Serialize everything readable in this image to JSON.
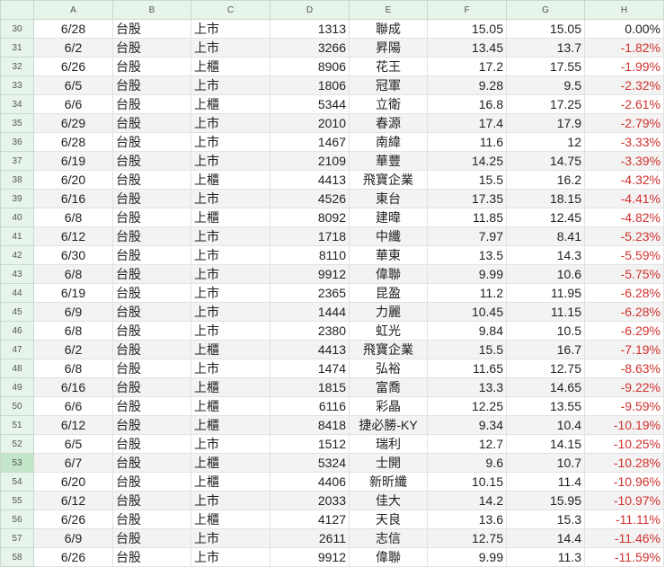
{
  "columns": [
    "A",
    "B",
    "C",
    "D",
    "E",
    "F",
    "G",
    "H"
  ],
  "selected_row": 53,
  "rows": [
    [
      "30",
      "6/28",
      "台股",
      "上市",
      "1313",
      "聯成",
      "15.05",
      "15.05",
      "0.00%"
    ],
    [
      "31",
      "6/2",
      "台股",
      "上市",
      "3266",
      "昇陽",
      "13.45",
      "13.7",
      "-1.82%"
    ],
    [
      "32",
      "6/26",
      "台股",
      "上櫃",
      "8906",
      "花王",
      "17.2",
      "17.55",
      "-1.99%"
    ],
    [
      "33",
      "6/5",
      "台股",
      "上市",
      "1806",
      "冠軍",
      "9.28",
      "9.5",
      "-2.32%"
    ],
    [
      "34",
      "6/6",
      "台股",
      "上櫃",
      "5344",
      "立衛",
      "16.8",
      "17.25",
      "-2.61%"
    ],
    [
      "35",
      "6/29",
      "台股",
      "上市",
      "2010",
      "春源",
      "17.4",
      "17.9",
      "-2.79%"
    ],
    [
      "36",
      "6/28",
      "台股",
      "上市",
      "1467",
      "南緯",
      "11.6",
      "12",
      "-3.33%"
    ],
    [
      "37",
      "6/19",
      "台股",
      "上市",
      "2109",
      "華豐",
      "14.25",
      "14.75",
      "-3.39%"
    ],
    [
      "38",
      "6/20",
      "台股",
      "上櫃",
      "4413",
      "飛寶企業",
      "15.5",
      "16.2",
      "-4.32%"
    ],
    [
      "39",
      "6/16",
      "台股",
      "上市",
      "4526",
      "東台",
      "17.35",
      "18.15",
      "-4.41%"
    ],
    [
      "40",
      "6/8",
      "台股",
      "上櫃",
      "8092",
      "建暐",
      "11.85",
      "12.45",
      "-4.82%"
    ],
    [
      "41",
      "6/12",
      "台股",
      "上市",
      "1718",
      "中纖",
      "7.97",
      "8.41",
      "-5.23%"
    ],
    [
      "42",
      "6/30",
      "台股",
      "上市",
      "8110",
      "華東",
      "13.5",
      "14.3",
      "-5.59%"
    ],
    [
      "43",
      "6/8",
      "台股",
      "上市",
      "9912",
      "偉聯",
      "9.99",
      "10.6",
      "-5.75%"
    ],
    [
      "44",
      "6/19",
      "台股",
      "上市",
      "2365",
      "昆盈",
      "11.2",
      "11.95",
      "-6.28%"
    ],
    [
      "45",
      "6/9",
      "台股",
      "上市",
      "1444",
      "力麗",
      "10.45",
      "11.15",
      "-6.28%"
    ],
    [
      "46",
      "6/8",
      "台股",
      "上市",
      "2380",
      "虹光",
      "9.84",
      "10.5",
      "-6.29%"
    ],
    [
      "47",
      "6/2",
      "台股",
      "上櫃",
      "4413",
      "飛寶企業",
      "15.5",
      "16.7",
      "-7.19%"
    ],
    [
      "48",
      "6/8",
      "台股",
      "上市",
      "1474",
      "弘裕",
      "11.65",
      "12.75",
      "-8.63%"
    ],
    [
      "49",
      "6/16",
      "台股",
      "上櫃",
      "1815",
      "富喬",
      "13.3",
      "14.65",
      "-9.22%"
    ],
    [
      "50",
      "6/6",
      "台股",
      "上櫃",
      "6116",
      "彩晶",
      "12.25",
      "13.55",
      "-9.59%"
    ],
    [
      "51",
      "6/12",
      "台股",
      "上櫃",
      "8418",
      "捷必勝-KY",
      "9.34",
      "10.4",
      "-10.19%"
    ],
    [
      "52",
      "6/5",
      "台股",
      "上市",
      "1512",
      "瑞利",
      "12.7",
      "14.15",
      "-10.25%"
    ],
    [
      "53",
      "6/7",
      "台股",
      "上櫃",
      "5324",
      "士開",
      "9.6",
      "10.7",
      "-10.28%"
    ],
    [
      "54",
      "6/20",
      "台股",
      "上櫃",
      "4406",
      "新昕纖",
      "10.15",
      "11.4",
      "-10.96%"
    ],
    [
      "55",
      "6/12",
      "台股",
      "上市",
      "2033",
      "佳大",
      "14.2",
      "15.95",
      "-10.97%"
    ],
    [
      "56",
      "6/26",
      "台股",
      "上櫃",
      "4127",
      "天良",
      "13.6",
      "15.3",
      "-11.11%"
    ],
    [
      "57",
      "6/9",
      "台股",
      "上市",
      "2611",
      "志信",
      "12.75",
      "14.4",
      "-11.46%"
    ],
    [
      "58",
      "6/26",
      "台股",
      "上市",
      "9912",
      "偉聯",
      "9.99",
      "11.3",
      "-11.59%"
    ]
  ]
}
